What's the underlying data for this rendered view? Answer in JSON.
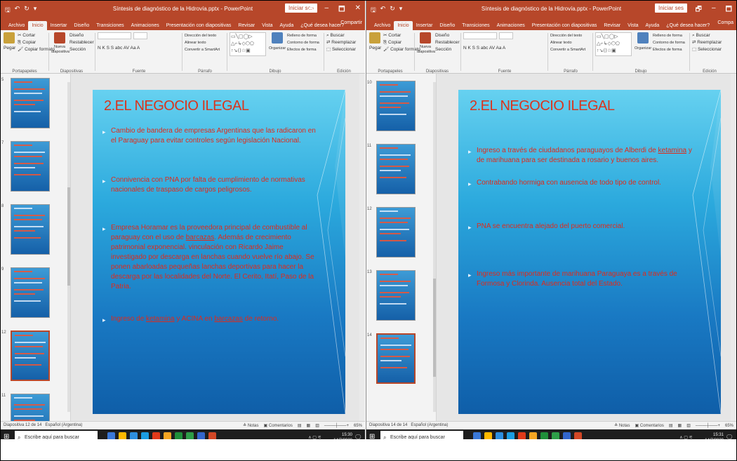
{
  "windows": [
    {
      "title": "Síntesis de diagnóstico de la Hidrovía.pptx - PowerPoint",
      "signin": "Iniciar ses",
      "controls": [
        "🗗",
        "–",
        "🗖",
        "✕"
      ],
      "tabs": [
        "Archivo",
        "Inicio",
        "Insertar",
        "Diseño",
        "Transiciones",
        "Animaciones",
        "Presentación con diapositivas",
        "Revisar",
        "Vista",
        "Ayuda",
        "¿Qué desea hacer?"
      ],
      "share": "Compartir",
      "ribbon": {
        "paste": "Pegar",
        "cut": "Cortar",
        "copy": "Copiar",
        "format_painter": "Copiar formato",
        "new_slide": "Nueva diapositiva",
        "layout": "Diseño",
        "reset": "Restablecer",
        "section": "Sección",
        "font_row": "N K S S abc AV Aa A",
        "align": "Dirección del texto",
        "align_text": "Alinear texto",
        "smartart": "Convertir a SmartArt",
        "arrange": "Organizar",
        "quick_styles": "Estilos rápidos",
        "fill": "Relleno de forma",
        "outline": "Contorno de forma",
        "effects": "Efectos de forma",
        "find": "Buscar",
        "replace": "Reemplazar",
        "select": "Seleccionar",
        "groups": [
          "Portapapeles",
          "Diapositivas",
          "Fuente",
          "Párrafo",
          "Dibujo",
          "Edición"
        ]
      },
      "thumbnails": [
        {
          "num": "5"
        },
        {
          "num": "7"
        },
        {
          "num": "8"
        },
        {
          "num": "9"
        },
        {
          "num": "12",
          "selected": true
        },
        {
          "num": "11"
        }
      ],
      "slide": {
        "title": "2.EL NEGOCIO ILEGAL",
        "bullets": [
          [
            "Cambio de bandera de empresas Argentinas que las radicaron en el Paraguay para evitar controles según legislación Nacional."
          ],
          [
            "Connivencia con PNA por falta de cumplimiento de normativas nacionales de traspaso de cargos peligrosos."
          ],
          [
            "Empresa Horamar es la proveedora principal de combustible al paraguay con el uso de ",
            "barcazas",
            ". Además de crecimiento patrimonial exponencial. vinculación con Ricardo Jaime investigado por descarga en lanchas cuando vuelve río abajo. Se ponen abarloadas pequeñas lanchas deportivas para hacer la descarga por las localidades del Norte. El Cerito, Itatí, Paso de la Patria."
          ],
          [
            "Ingreso de ",
            "ketamina",
            " y ACINA en ",
            "barcazas",
            " de retorno."
          ]
        ]
      },
      "status": {
        "slide": "Diapositiva 12 de 14",
        "lang": "Español (Argentina)",
        "notes": "Notas",
        "comments": "Comentarios",
        "zoom": "65%"
      },
      "taskbar": {
        "search": "Escribe aquí para buscar",
        "time": "15:30",
        "date": "14/7/2020",
        "tray": "∧ ▢ ⚟"
      }
    },
    {
      "title": "Síntesis de diagnóstico de la Hidrovía.pptx - PowerPoint",
      "signin": "Iniciar ses",
      "controls": [
        "🗗",
        "–",
        "🗖"
      ],
      "tabs": [
        "Archivo",
        "Inicio",
        "Insertar",
        "Diseño",
        "Transiciones",
        "Animaciones",
        "Presentación con diapositivas",
        "Revisar",
        "Vista",
        "Ayuda",
        "¿Qué desea hacer?"
      ],
      "share": "Compa",
      "ribbon": {
        "paste": "Pegar",
        "cut": "Cortar",
        "copy": "Copiar",
        "format_painter": "Copiar formato",
        "new_slide": "Nueva diapositiva",
        "layout": "Diseño",
        "reset": "Restablecer",
        "section": "Sección",
        "font_row": "N K S S abc AV Aa A",
        "align": "Dirección del texto",
        "align_text": "Alinear texto",
        "smartart": "Convertir a SmartArt",
        "arrange": "Organizar",
        "quick_styles": "Estilos rápidos",
        "fill": "Relleno de forma",
        "outline": "Contorno de forma",
        "effects": "Efectos de forma",
        "find": "Buscar",
        "replace": "Reemplazar",
        "select": "Seleccionar",
        "groups": [
          "Portapapeles",
          "Diapositivas",
          "Fuente",
          "Párrafo",
          "Dibujo",
          "Edición"
        ]
      },
      "thumbnails": [
        {
          "num": "10"
        },
        {
          "num": "11"
        },
        {
          "num": "12"
        },
        {
          "num": "13"
        },
        {
          "num": "14",
          "selected": true
        }
      ],
      "slide": {
        "title": "2.EL NEGOCIO ILEGAL",
        "bullets": [
          [
            "Ingreso a través de ciudadanos paraguayos de Alberdi de ",
            "ketamina",
            " y de marihuana para ser destinada a rosario y buenos aires."
          ],
          [
            "Contrabando hormiga con ausencia de todo tipo de control."
          ],
          [
            "PNA se encuentra alejado del puerto comercial."
          ],
          [
            "Ingreso más importante de marihuana Paraguaya es a través de Formosa y Clorinda. Ausencia total del Estado."
          ]
        ]
      },
      "status": {
        "slide": "Diapositiva 14 de 14",
        "lang": "Español (Argentina)",
        "notes": "Notas",
        "comments": "Comentarios",
        "zoom": "65%"
      },
      "taskbar": {
        "search": "Escribe aquí para buscar",
        "time": "15:31",
        "date": "14/7/2020",
        "tray": "∧ ▢ ⚟"
      }
    }
  ],
  "colors": {
    "accent": "#b7472a",
    "slide_text": "#e02a1a",
    "taskbar": "#1e1e1e"
  }
}
